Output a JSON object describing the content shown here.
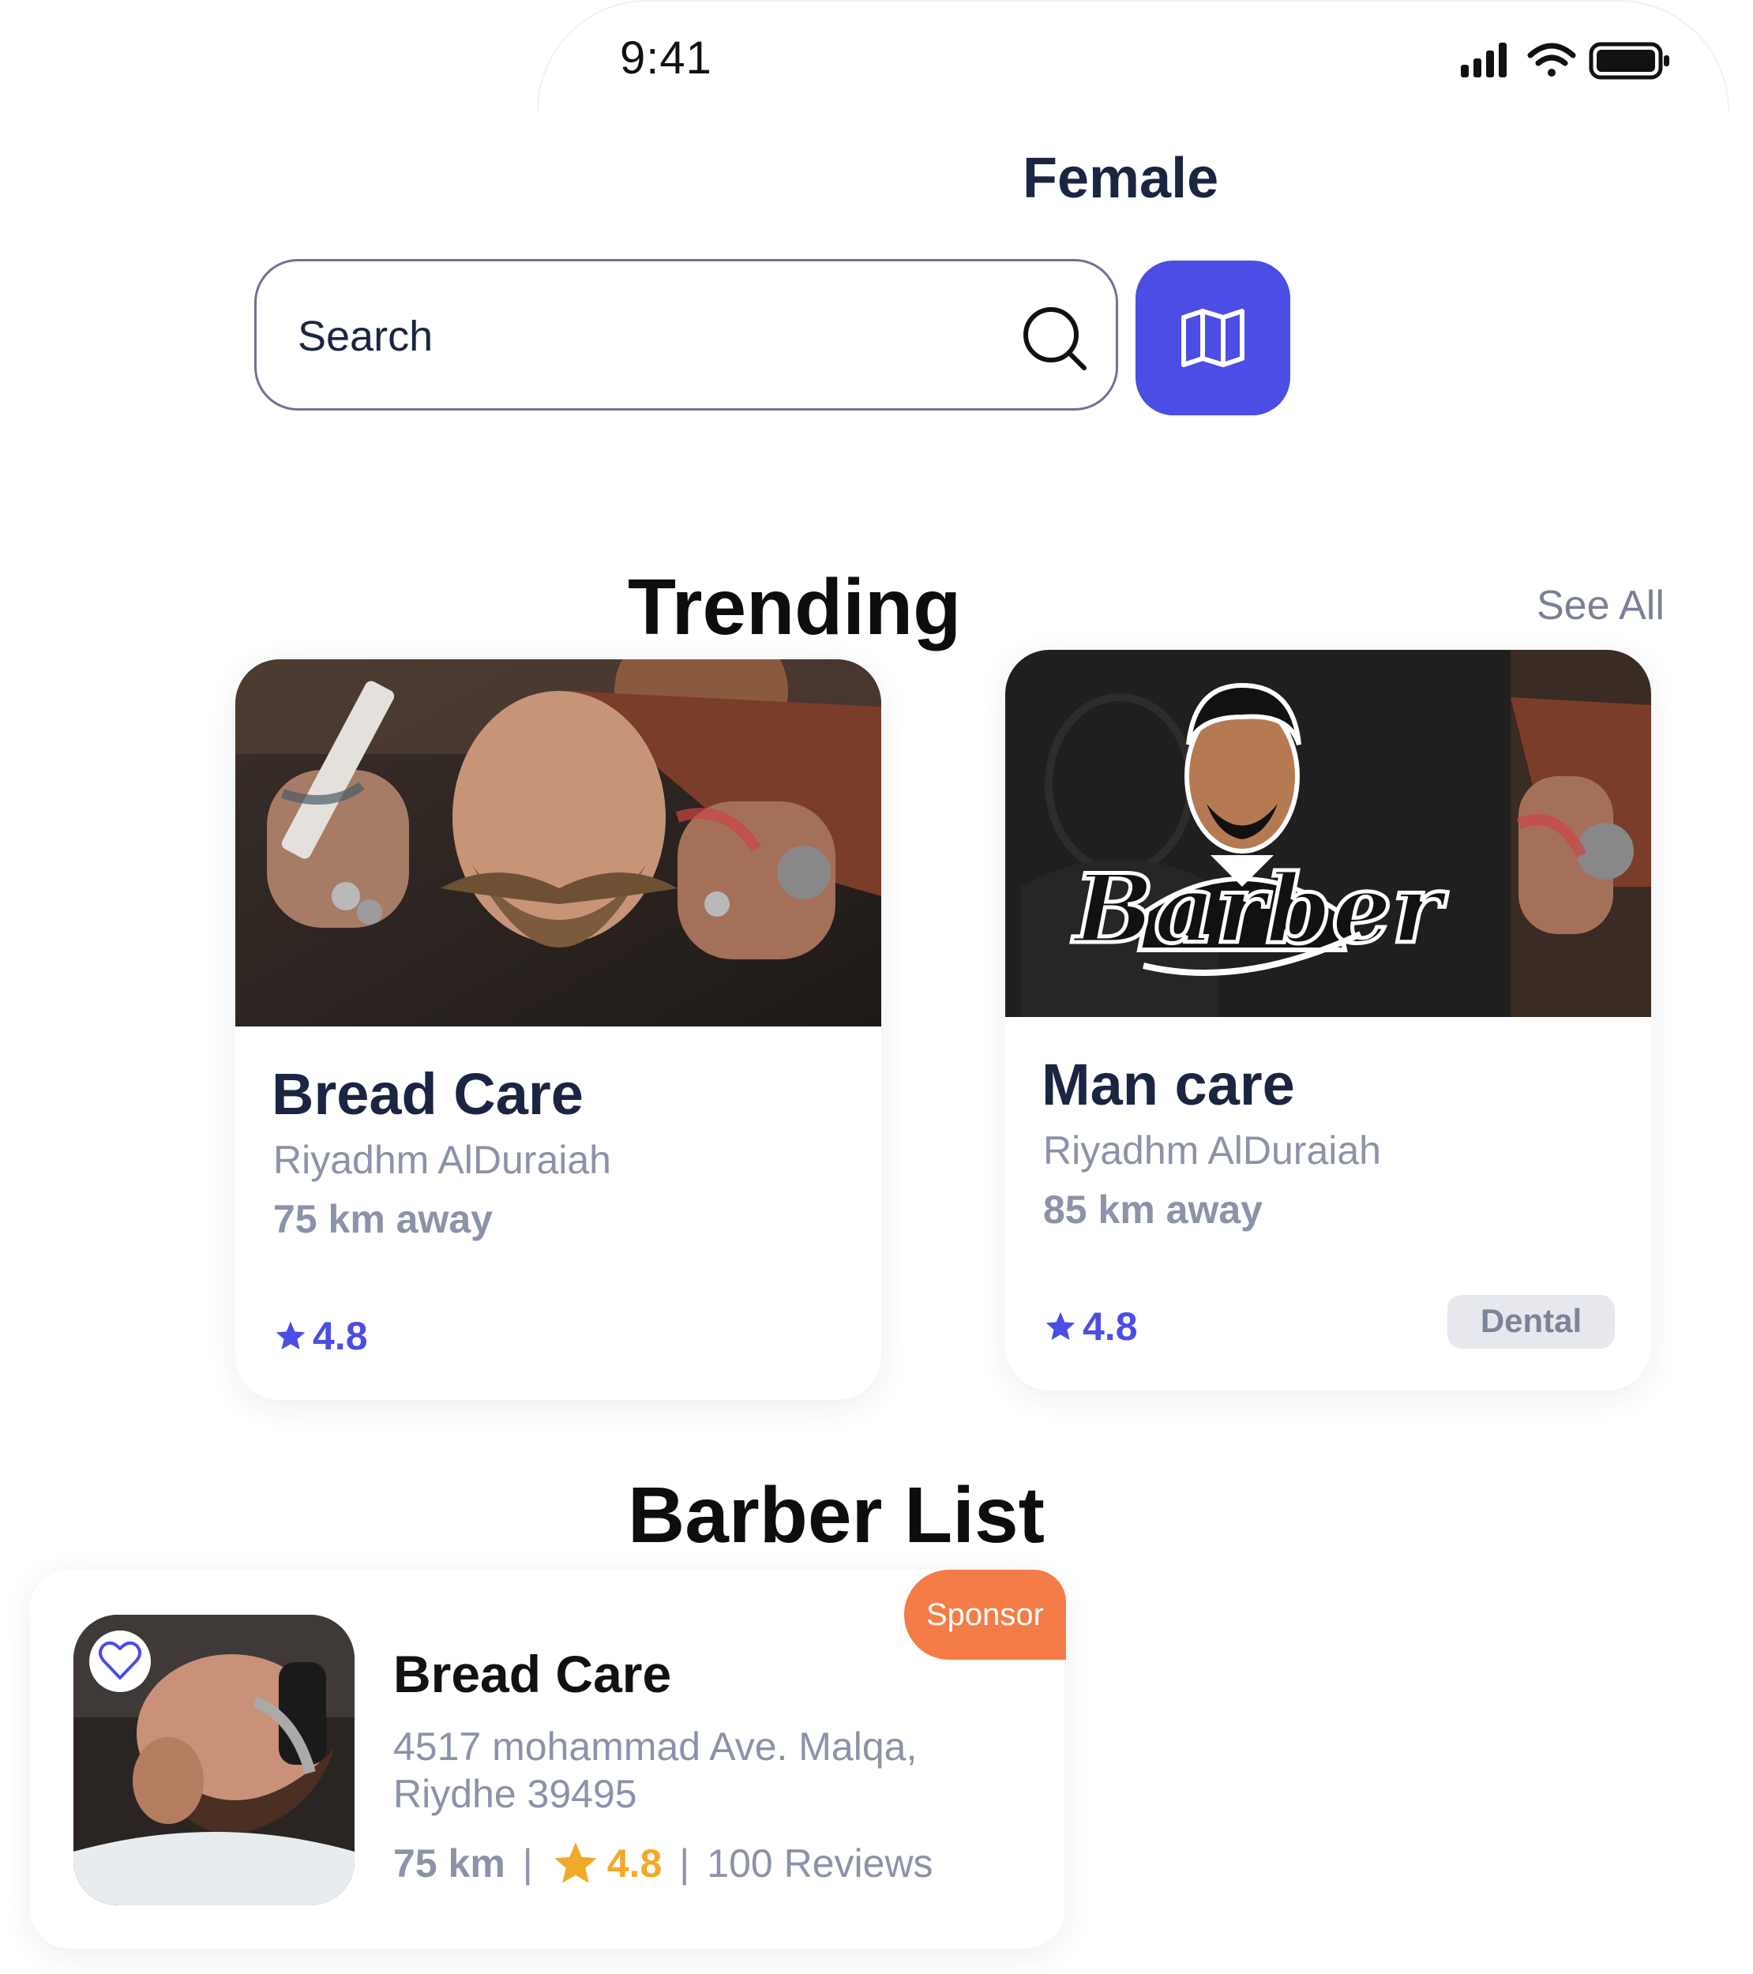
{
  "status_bar": {
    "time": "9:41"
  },
  "header": {
    "title": "Female"
  },
  "search": {
    "placeholder": "Search"
  },
  "trending": {
    "title": "Trending",
    "see_all": "See All",
    "cards": [
      {
        "name": "Bread Care",
        "owner": "Riyadhm AlDuraiah",
        "distance": "75 km away",
        "rating": "4.8"
      },
      {
        "name": "Man care",
        "owner": "Riyadhm AlDuraiah",
        "distance": "85 km away",
        "rating": "4.8",
        "tag": "Dental",
        "logo_text": "Barber"
      }
    ]
  },
  "barber_list": {
    "title": "Barber List",
    "items": [
      {
        "badge": "Sponsor",
        "name": "Bread Care",
        "address": "4517 mohammad Ave. Malqa, Riydhe 39495",
        "distance": "75 km",
        "rating": "4.8",
        "reviews": "100 Reviews"
      }
    ]
  },
  "colors": {
    "accent": "#4b4de4",
    "sponsor": "#f47c46",
    "star": "#f2a92a",
    "title": "#1b2541"
  }
}
